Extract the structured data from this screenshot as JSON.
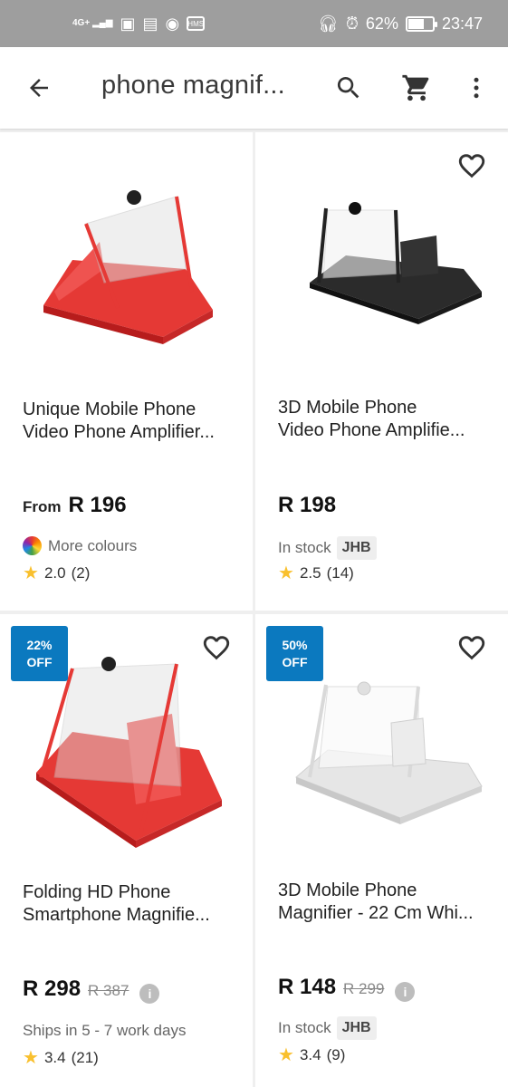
{
  "status_bar": {
    "network": "4G+",
    "battery_text": "62%",
    "battery_level": 0.62,
    "time": "23:47",
    "mini_icon_label": "HMS"
  },
  "app_bar": {
    "title": "phone magnif...",
    "icons": [
      "back-arrow-icon",
      "search-icon",
      "cart-icon",
      "more-vert-icon"
    ]
  },
  "colors": {
    "badge": "#0b79bf",
    "star": "#f9c02e",
    "status_bar": "#9e9e9e"
  },
  "products": [
    {
      "name_line1": "Unique Mobile Phone",
      "name_line2": "Video Phone Amplifier...",
      "price_prefix": "From",
      "price": "R 196",
      "availability": "More colours",
      "rating": "2.0",
      "reviews": "(2)",
      "image_color": "red"
    },
    {
      "name_line1": "3D Mobile Phone",
      "name_line2": "Video Phone Amplifie...",
      "price": "R 198",
      "availability": "In stock",
      "warehouse": "JHB",
      "rating": "2.5",
      "reviews": "(14)",
      "image_color": "black"
    },
    {
      "badge_line1": "22%",
      "badge_line2": "OFF",
      "name_line1": "Folding HD Phone",
      "name_line2": "Smartphone Magnifie...",
      "price": "R 298",
      "old_price": "R 387",
      "availability": "Ships in 5 - 7 work days",
      "rating": "3.4",
      "reviews": "(21)",
      "image_color": "red"
    },
    {
      "badge_line1": "50%",
      "badge_line2": "OFF",
      "name_line1": "3D Mobile Phone",
      "name_line2": "Magnifier - 22 Cm Whi...",
      "price": "R 148",
      "old_price": "R 299",
      "availability": "In stock",
      "warehouse": "JHB",
      "rating": "3.4",
      "reviews": "(9)",
      "image_color": "white"
    }
  ]
}
